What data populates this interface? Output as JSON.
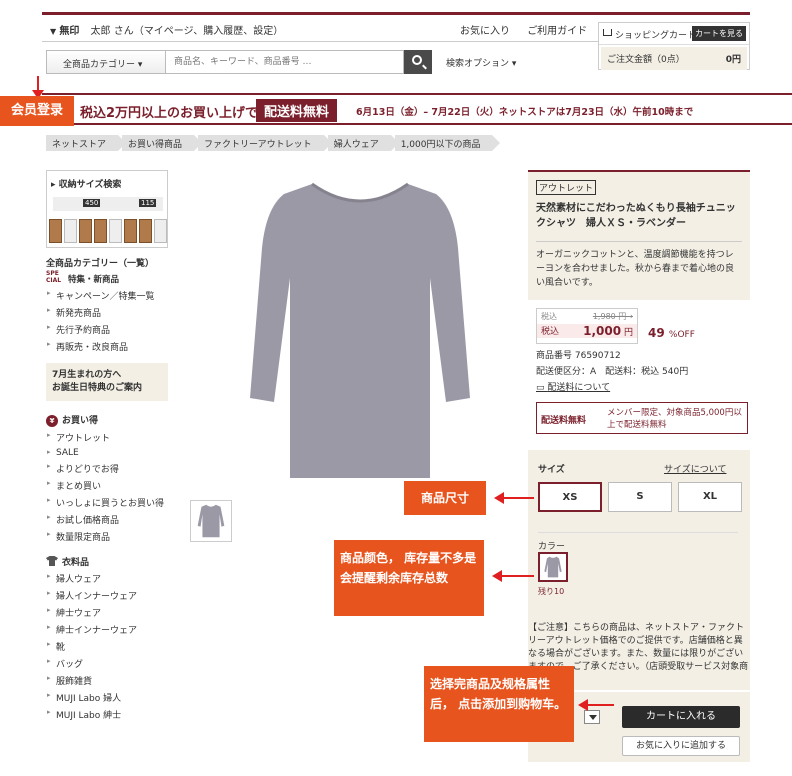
{
  "header": {
    "menu_icon": "▼",
    "store": "無印",
    "user_line": "太郎 さん（マイページ、購入履歴、設定）",
    "links": [
      "お気に入り",
      "ご利用ガイド"
    ]
  },
  "cart": {
    "title": "ショッピングカート",
    "view_button": "カートを見る",
    "total_label": "ご注文金額（0点）",
    "total_value": "0円"
  },
  "search": {
    "category_label": "全商品カテゴリー ▾",
    "placeholder": "商品名、キーワード、商品番号 …",
    "options_label": "検索オプション ▾"
  },
  "banner": {
    "text1": "税込2万円以上のお買い上げで",
    "free_label": "配送料無料",
    "dates": "6月13日（金）– 7月22日（火）ネットストアは7月23日（水）午前10時まで"
  },
  "breadcrumbs": [
    "ネットストア",
    "お買い得商品",
    "ファクトリーアウトレット",
    "婦人ウェア",
    "1,000円以下の商品"
  ],
  "sidebar": {
    "size_search_title": "▸ 収納サイズ検索",
    "slider_w": "450",
    "slider_h": "115",
    "categories_title": "全商品カテゴリー（一覧）",
    "special_badge": "SPE CIAL",
    "special_title": "特集・新商品",
    "special_items": [
      "キャンペーン／特集一覧",
      "新発売商品",
      "先行予約商品",
      "再販売・改良商品"
    ],
    "promo_line1": "7月生まれの方へ",
    "promo_line2": "お誕生日特典のご案内",
    "bargain_title": "お買い得",
    "bargain_icon": "¥",
    "bargain_items": [
      "アウトレット",
      "SALE",
      "よりどりでお得",
      "まとめ買い",
      "いっしょに買うとお買い得",
      "お試し価格商品",
      "数量限定商品"
    ],
    "clothing_title": "衣料品",
    "clothing_items": [
      "婦人ウェア",
      "婦人インナーウェア",
      "紳士ウェア",
      "紳士インナーウェア",
      "靴",
      "バッグ",
      "服飾雑貨",
      "MUJI Labo 婦人",
      "MUJI Labo 紳士"
    ]
  },
  "product": {
    "tag": "アウトレット",
    "title": "天然素材にこだわったぬくもり長袖チュニックシャツ　婦人ＸＳ・ラベンダー",
    "description": "オーガニックコットンと、温度調節機能を持つレーヨンを合わせました。秋から春まで着心地の良い風合いです。",
    "price_old_label": "税込",
    "price_old": "1,980 円→",
    "price_new_label": "税込",
    "price_new": "1,000",
    "price_unit": "円",
    "discount": "49",
    "discount_unit": "%OFF",
    "item_no": "商品番号 76590712",
    "shipping_class": "配送便区分：A　配送料：税込 540円",
    "shipping_link": "配送料について",
    "ship_free_label": "配送料無料",
    "ship_free_note": "メンバー限定、対象商品5,000円以上で配送料無料",
    "size_label": "サイズ",
    "size_guide": "サイズについて",
    "sizes": [
      "XS",
      "S",
      "XL"
    ],
    "color_label": "カラー",
    "stock": "残り10",
    "notice": "【ご注意】こちらの商品は、ネットストア・ファクトリーアウトレット価格でのご提供です。店舗価格と異なる場合がございます。また、数量には限りがございますので、ご了承ください。（店頭受取サービス対象商品）",
    "add_cart": "カートに入れる",
    "add_fav": "お気に入りに追加する"
  },
  "annotations": {
    "login": "会员登录",
    "size": "商品尺寸",
    "color": "商品颜色，  库存量不多是会提醒剩余库存总数",
    "cart": "选择完商品及规格属性后，  点击添加到购物车。"
  },
  "colors": {
    "brand": "#7a1f2b",
    "note": "#e8541e",
    "arrow": "#e02020",
    "garment": "#9c99a6"
  }
}
